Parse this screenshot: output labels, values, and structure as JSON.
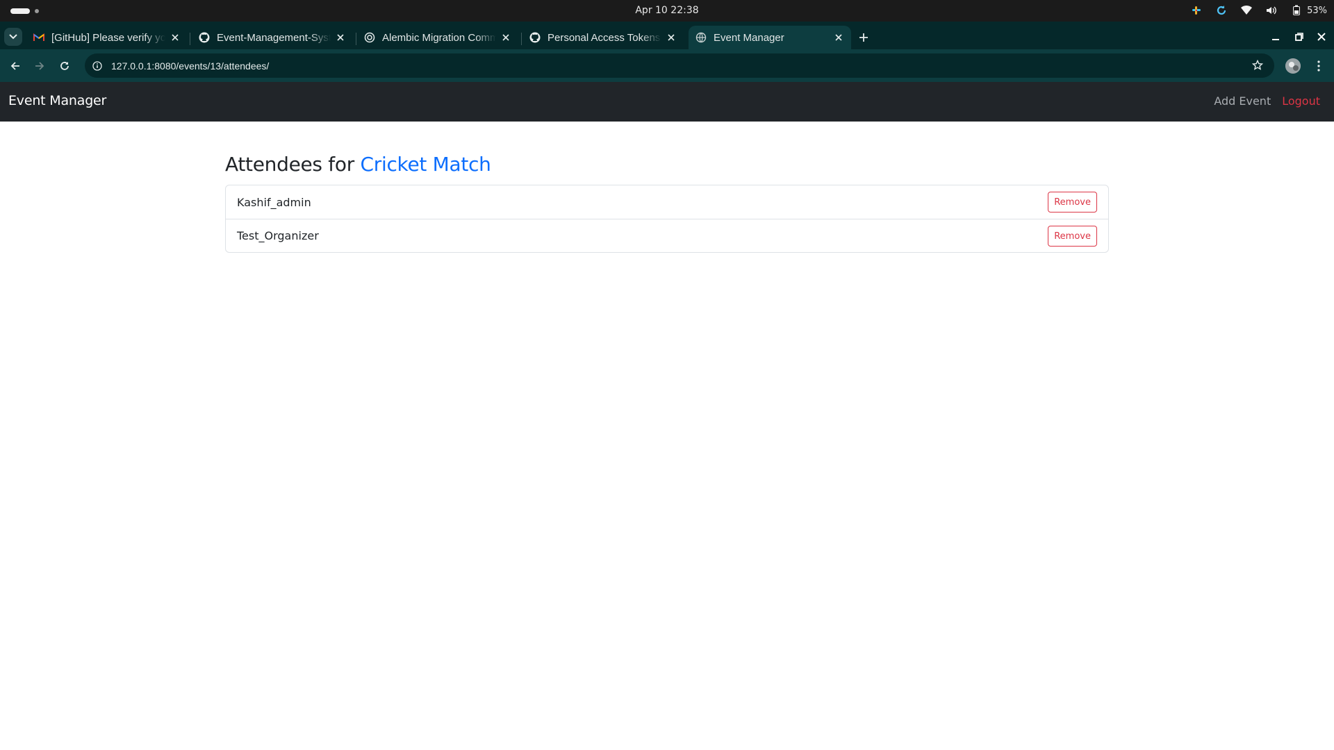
{
  "os": {
    "clock": "Apr 10  22:38",
    "battery": "53%",
    "tray_icons": [
      "slack-icon",
      "refresh-icon",
      "wifi-icon",
      "volume-icon",
      "battery-icon"
    ]
  },
  "browser": {
    "tabs": [
      {
        "title": "[GitHub] Please verify your device",
        "icon": "gmail-icon",
        "active": false
      },
      {
        "title": "Event-Management-System",
        "icon": "github-icon",
        "active": false
      },
      {
        "title": "Alembic Migration Commands",
        "icon": "globe-icon",
        "active": false
      },
      {
        "title": "Personal Access Tokens (Classic)",
        "icon": "github-icon",
        "active": false
      },
      {
        "title": "Event Manager",
        "icon": "globe-icon",
        "active": true
      }
    ],
    "url": "127.0.0.1:8080/events/13/attendees/"
  },
  "app": {
    "brand": "Event Manager",
    "nav": {
      "add_event": "Add Event",
      "logout": "Logout"
    },
    "page": {
      "heading_prefix": "Attendees for ",
      "event_name": "Cricket Match",
      "attendees": [
        {
          "name": "Kashif_admin",
          "action": "Remove"
        },
        {
          "name": "Test_Organizer",
          "action": "Remove"
        }
      ]
    }
  },
  "colors": {
    "navbar_bg": "#212529",
    "link_blue": "#0d6efd",
    "danger_red": "#dc3545",
    "browser_frame": "#0d3d40"
  }
}
